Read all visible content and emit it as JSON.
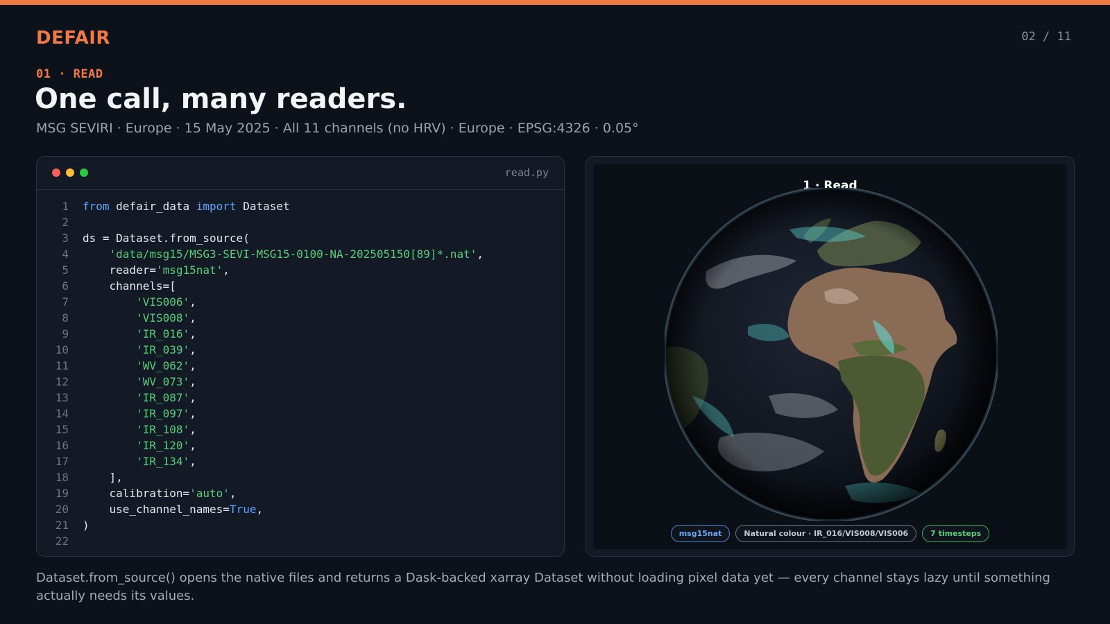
{
  "brand": "DEFAIR",
  "pager": "02 / 11",
  "section": "01 · READ",
  "title": "One call, many readers.",
  "subtitle": "MSG SEVIRI · Europe · 15 May 2025 · All 11 channels (no HRV) · Europe · EPSG:4326 · 0.05°",
  "code": {
    "filename": "read.py",
    "lines": [
      {
        "n": "1",
        "segs": [
          {
            "t": "from",
            "c": "kw"
          },
          {
            "t": " defair_data ",
            "c": ""
          },
          {
            "t": "import",
            "c": "kw"
          },
          {
            "t": " Dataset",
            "c": ""
          }
        ]
      },
      {
        "n": "2",
        "segs": []
      },
      {
        "n": "3",
        "segs": [
          {
            "t": "ds = Dataset.from_source(",
            "c": ""
          }
        ]
      },
      {
        "n": "4",
        "segs": [
          {
            "t": "    ",
            "c": ""
          },
          {
            "t": "'data/msg15/MSG3-SEVI-MSG15-0100-NA-202505150[89]*.nat'",
            "c": "str"
          },
          {
            "t": ",",
            "c": ""
          }
        ]
      },
      {
        "n": "5",
        "segs": [
          {
            "t": "    reader=",
            "c": ""
          },
          {
            "t": "'msg15nat'",
            "c": "str"
          },
          {
            "t": ",",
            "c": ""
          }
        ]
      },
      {
        "n": "6",
        "segs": [
          {
            "t": "    channels=[",
            "c": ""
          }
        ]
      },
      {
        "n": "7",
        "segs": [
          {
            "t": "        ",
            "c": ""
          },
          {
            "t": "'VIS006'",
            "c": "str"
          },
          {
            "t": ",",
            "c": ""
          }
        ]
      },
      {
        "n": "8",
        "segs": [
          {
            "t": "        ",
            "c": ""
          },
          {
            "t": "'VIS008'",
            "c": "str"
          },
          {
            "t": ",",
            "c": ""
          }
        ]
      },
      {
        "n": "9",
        "segs": [
          {
            "t": "        ",
            "c": ""
          },
          {
            "t": "'IR_016'",
            "c": "str"
          },
          {
            "t": ",",
            "c": ""
          }
        ]
      },
      {
        "n": "10",
        "segs": [
          {
            "t": "        ",
            "c": ""
          },
          {
            "t": "'IR_039'",
            "c": "str"
          },
          {
            "t": ",",
            "c": ""
          }
        ]
      },
      {
        "n": "11",
        "segs": [
          {
            "t": "        ",
            "c": ""
          },
          {
            "t": "'WV_062'",
            "c": "str"
          },
          {
            "t": ",",
            "c": ""
          }
        ]
      },
      {
        "n": "12",
        "segs": [
          {
            "t": "        ",
            "c": ""
          },
          {
            "t": "'WV_073'",
            "c": "str"
          },
          {
            "t": ",",
            "c": ""
          }
        ]
      },
      {
        "n": "13",
        "segs": [
          {
            "t": "        ",
            "c": ""
          },
          {
            "t": "'IR_087'",
            "c": "str"
          },
          {
            "t": ",",
            "c": ""
          }
        ]
      },
      {
        "n": "14",
        "segs": [
          {
            "t": "        ",
            "c": ""
          },
          {
            "t": "'IR_097'",
            "c": "str"
          },
          {
            "t": ",",
            "c": ""
          }
        ]
      },
      {
        "n": "15",
        "segs": [
          {
            "t": "        ",
            "c": ""
          },
          {
            "t": "'IR_108'",
            "c": "str"
          },
          {
            "t": ",",
            "c": ""
          }
        ]
      },
      {
        "n": "16",
        "segs": [
          {
            "t": "        ",
            "c": ""
          },
          {
            "t": "'IR_120'",
            "c": "str"
          },
          {
            "t": ",",
            "c": ""
          }
        ]
      },
      {
        "n": "17",
        "segs": [
          {
            "t": "        ",
            "c": ""
          },
          {
            "t": "'IR_134'",
            "c": "str"
          },
          {
            "t": ",",
            "c": ""
          }
        ]
      },
      {
        "n": "18",
        "segs": [
          {
            "t": "    ],",
            "c": ""
          }
        ]
      },
      {
        "n": "19",
        "segs": [
          {
            "t": "    calibration=",
            "c": ""
          },
          {
            "t": "'auto'",
            "c": "str"
          },
          {
            "t": ",",
            "c": ""
          }
        ]
      },
      {
        "n": "20",
        "segs": [
          {
            "t": "    use_channel_names=",
            "c": ""
          },
          {
            "t": "True",
            "c": "kw"
          },
          {
            "t": ",",
            "c": ""
          }
        ]
      },
      {
        "n": "21",
        "segs": [
          {
            "t": ")",
            "c": ""
          }
        ]
      },
      {
        "n": "22",
        "segs": []
      }
    ]
  },
  "viz": {
    "title": "1 · Read",
    "badges": {
      "reader": "msg15nat",
      "composite": "Natural colour · IR_016/VIS008/VIS006",
      "timesteps": "7 timesteps"
    }
  },
  "footer": "Dataset.from_source() opens the native files and returns a Dask-backed xarray Dataset without loading pixel data yet — every channel stays lazy until something actually needs its values.",
  "colors": {
    "accent": "#f07a46",
    "keyword": "#5aa7ff",
    "string": "#57d07a",
    "background": "#0d1119"
  }
}
